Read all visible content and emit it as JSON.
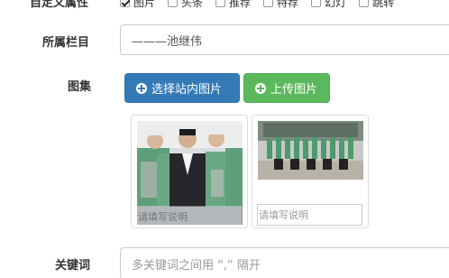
{
  "custom_attributes": {
    "label": "自定义属性",
    "options": [
      {
        "label": "图片",
        "checked": true
      },
      {
        "label": "头条",
        "checked": false
      },
      {
        "label": "推荐",
        "checked": false
      },
      {
        "label": "特荐",
        "checked": false
      },
      {
        "label": "幻灯",
        "checked": false
      },
      {
        "label": "跳转",
        "checked": false
      }
    ]
  },
  "column": {
    "label": "所属栏目",
    "value": "———池继伟"
  },
  "gallery": {
    "label": "图集",
    "select_button": "选择站内图片",
    "upload_button": "上传图片",
    "images": [
      {
        "caption_placeholder": "请填写说明"
      },
      {
        "caption_placeholder": "请填写说明"
      }
    ]
  },
  "keywords": {
    "label": "关键词",
    "placeholder": "多关键词之间用 “,” 隔开"
  },
  "colors": {
    "primary": "#337ab7",
    "success": "#5cb85c",
    "border": "#cccccc"
  }
}
